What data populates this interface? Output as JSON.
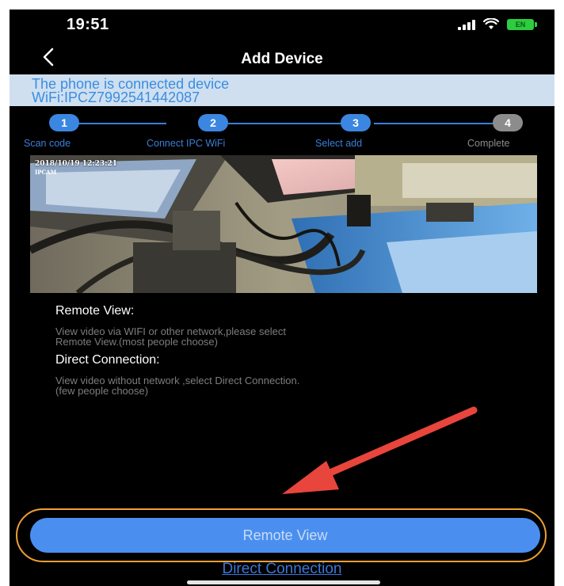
{
  "status_bar": {
    "time": "19:51",
    "battery_label": "EN"
  },
  "nav": {
    "title": "Add Device",
    "back_icon": "chevron-left-icon"
  },
  "banner": {
    "line1": "The phone is connected device",
    "line2": "WiFi:IPCZ7992541442087"
  },
  "steps": [
    {
      "number": "1",
      "label": "Scan code",
      "state": "active"
    },
    {
      "number": "2",
      "label": "Connect IPC WiFi",
      "state": "active"
    },
    {
      "number": "3",
      "label": "Select add",
      "state": "active"
    },
    {
      "number": "4",
      "label": "Complete",
      "state": "pending"
    }
  ],
  "preview": {
    "timestamp": "2018/10/19 12:23:21",
    "camera_label": "IPCAM"
  },
  "info": {
    "remote_heading": "Remote View:",
    "remote_text_line1": "View video via WIFI or other network,please select",
    "remote_text_line2": "Remote View.(most people choose)",
    "direct_heading": "Direct Connection:",
    "direct_text_line1": "View video without network ,select Direct Connection.",
    "direct_text_line2": "(few people choose)"
  },
  "buttons": {
    "remote_view": "Remote View",
    "direct_connection": "Direct Connection"
  },
  "colors": {
    "accent_blue": "#4a8ff0",
    "highlight_orange": "#f0a033",
    "arrow_red": "#e8453c",
    "banner_bg": "#cfdff0"
  }
}
